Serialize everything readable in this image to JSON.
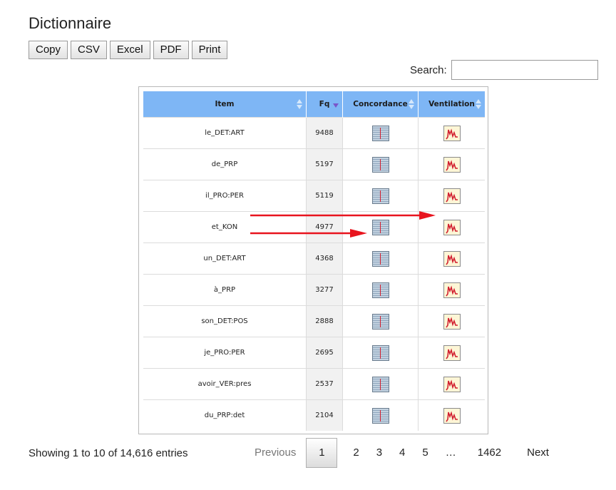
{
  "title": "Dictionnaire",
  "toolbar": {
    "buttons": [
      "Copy",
      "CSV",
      "Excel",
      "PDF",
      "Print"
    ]
  },
  "search": {
    "label": "Search:",
    "value": ""
  },
  "table": {
    "columns": [
      "Item",
      "Fq",
      "Concordance",
      "Ventilation"
    ],
    "sort": {
      "Fq": "desc"
    },
    "rows": [
      {
        "item": "le_DET:ART",
        "fq": "9488"
      },
      {
        "item": "de_PRP",
        "fq": "5197"
      },
      {
        "item": "il_PRO:PER",
        "fq": "5119"
      },
      {
        "item": "et_KON",
        "fq": "4977"
      },
      {
        "item": "un_DET:ART",
        "fq": "4368"
      },
      {
        "item": "à_PRP",
        "fq": "3277"
      },
      {
        "item": "son_DET:POS",
        "fq": "2888"
      },
      {
        "item": "je_PRO:PER",
        "fq": "2695"
      },
      {
        "item": "avoir_VER:pres",
        "fq": "2537"
      },
      {
        "item": "du_PRP:det",
        "fq": "2104"
      }
    ],
    "concordance_icon": "concordance-icon",
    "ventilation_icon": "ventilation-icon"
  },
  "annotations": {
    "arrow_color": "#e8141e"
  },
  "info": "Showing 1 to 10 of 14,616 entries",
  "pagination": {
    "previous": "Previous",
    "pages": [
      "1",
      "2",
      "3",
      "4",
      "5"
    ],
    "current": "1",
    "ellipsis": "…",
    "last": "1462",
    "next": "Next"
  },
  "colors": {
    "header_bg": "#7eb6f5",
    "fq_bg": "#f1f1f1"
  }
}
